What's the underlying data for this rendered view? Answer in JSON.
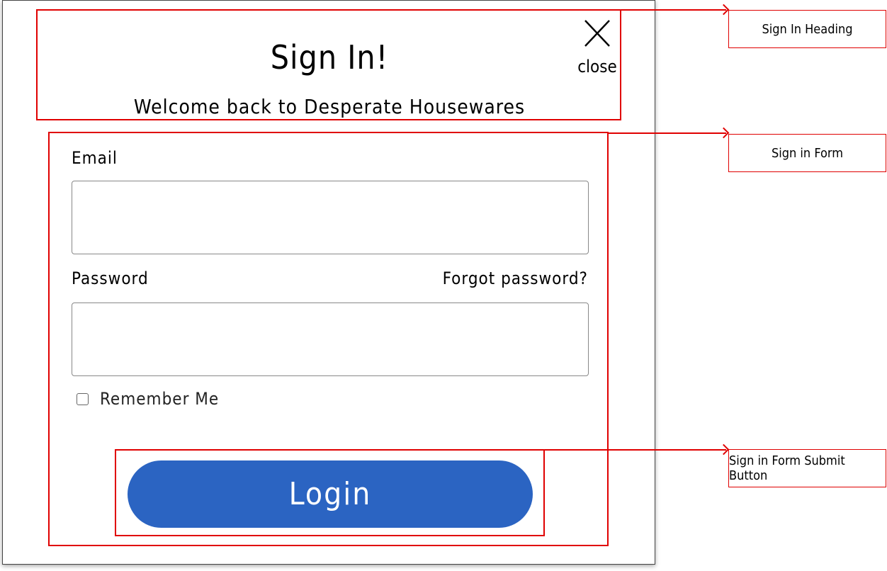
{
  "modal": {
    "title": "Sign In!",
    "subtitle": "Welcome back to Desperate Housewares",
    "close_label": "close"
  },
  "form": {
    "email_label": "Email",
    "email_value": "",
    "password_label": "Password",
    "password_value": "",
    "forgot_link": "Forgot password?",
    "remember_label": "Remember Me",
    "remember_checked": false,
    "submit_label": "Login"
  },
  "annotations": {
    "heading_label": "Sign In Heading",
    "form_label": "Sign in Form",
    "submit_label": "Sign in Form Submit Button",
    "color": "#e00000"
  },
  "colors": {
    "primary_button": "#2b64c2",
    "input_border": "#888888"
  },
  "icons": {
    "close": "close-x-icon"
  }
}
